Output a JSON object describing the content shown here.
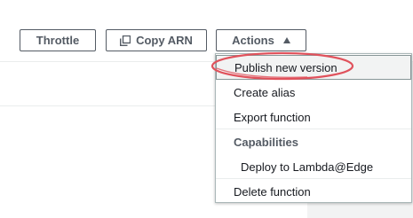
{
  "toolbar": {
    "throttle_label": "Throttle",
    "copy_arn_label": "Copy ARN",
    "copy_icon": "copy-icon",
    "actions_label": "Actions",
    "actions_icon": "caret-up-icon"
  },
  "actions_menu": {
    "items": [
      {
        "label": "Publish new version",
        "state": "hovered"
      },
      {
        "label": "Create alias"
      },
      {
        "label": "Export function"
      }
    ],
    "capabilities_heading": "Capabilities",
    "capabilities_items": [
      {
        "label": "Deploy to Lambda@Edge"
      }
    ],
    "footer_items": [
      {
        "label": "Delete function"
      }
    ]
  },
  "annotation": {
    "color": "#e0525c",
    "target": "Publish new version"
  },
  "colors": {
    "button_border": "#545b64",
    "menu_border": "#aab7b8",
    "hover_bg": "#f2f3f3"
  }
}
